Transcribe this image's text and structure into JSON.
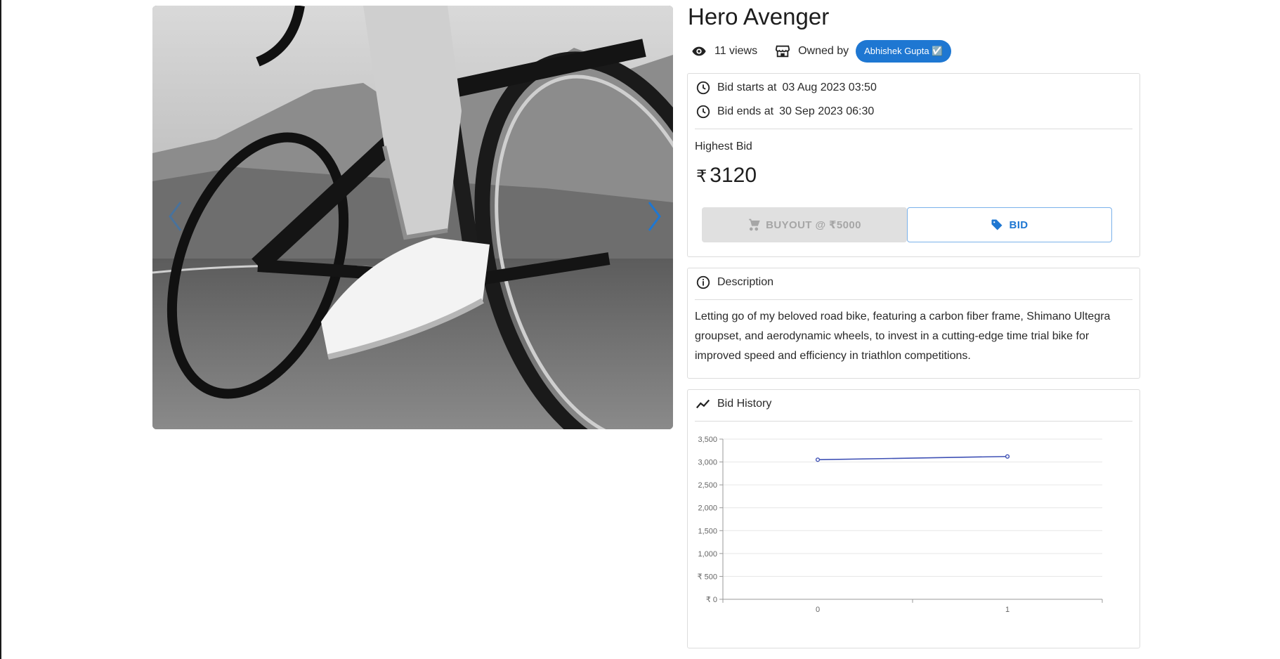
{
  "product": {
    "title": "Hero Avenger",
    "views": "11 views",
    "owned_by_label": "Owned by",
    "owner": "Abhishek Gupta ☑️"
  },
  "bid": {
    "starts_label": "Bid starts at",
    "starts_value": "03 Aug 2023 03:50",
    "ends_label": "Bid ends at",
    "ends_value": "30 Sep 2023 06:30",
    "highest_label": "Highest Bid",
    "currency_symbol": "₹",
    "highest_value": "3120",
    "buyout_label": "BUYOUT @ ₹5000",
    "bid_label": "BID"
  },
  "description": {
    "heading": "Description",
    "text": "Letting go of my beloved road bike, featuring a carbon fiber frame, Shimano Ultegra groupset, and aerodynamic wheels, to invest in a cutting-edge time trial bike for improved speed and efficiency in triathlon competitions."
  },
  "history": {
    "heading": "Bid History"
  },
  "chart_data": {
    "type": "line",
    "x": [
      0,
      1
    ],
    "series": [
      {
        "values": [
          3050,
          3120
        ]
      }
    ],
    "ylim": [
      0,
      3500
    ],
    "yticks": [
      "₹ 0",
      "₹ 500",
      "1,000",
      "1,500",
      "2,000",
      "2,500",
      "3,000",
      "3,500"
    ],
    "xticks": [
      "0",
      "1"
    ],
    "grid": true,
    "color": "#3f51b5"
  },
  "colors": {
    "accent": "#1e77d2",
    "chart_line": "#3f51b5"
  },
  "icons": {
    "views": "eye-icon",
    "owner": "store-icon",
    "time": "clock-icon",
    "info": "info-icon",
    "history": "trend-icon",
    "buyout": "cart-icon",
    "bid": "tag-icon"
  }
}
